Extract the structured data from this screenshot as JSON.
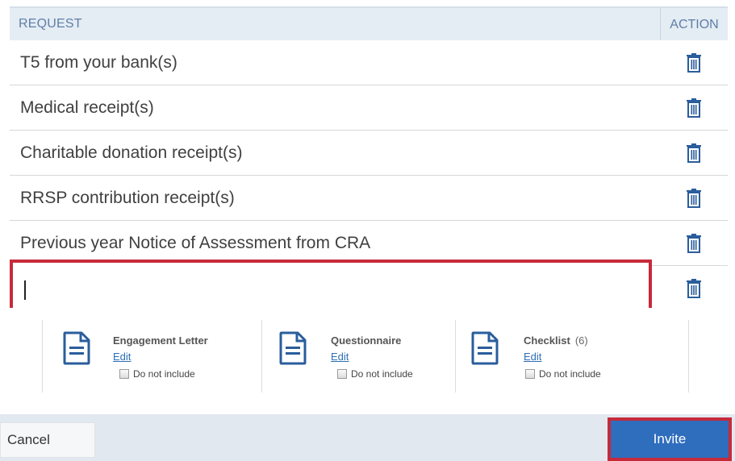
{
  "table": {
    "header_request": "REQUEST",
    "header_action": "ACTION",
    "rows": [
      {
        "label": "T5 from your bank(s)"
      },
      {
        "label": "Medical receipt(s)"
      },
      {
        "label": "Charitable donation receipt(s)"
      },
      {
        "label": "RRSP contribution receipt(s)"
      },
      {
        "label": "Previous year Notice of Assessment from CRA"
      }
    ],
    "new_request_value": "",
    "action_icon": "trash-icon"
  },
  "documents": [
    {
      "title": "Engagement Letter",
      "count": "",
      "edit": "Edit",
      "exclude": "Do not include",
      "icon": "document-icon"
    },
    {
      "title": "Questionnaire",
      "count": "",
      "edit": "Edit",
      "exclude": "Do not include",
      "icon": "document-icon"
    },
    {
      "title": "Checklist",
      "count": "(6)",
      "edit": "Edit",
      "exclude": "Do not include",
      "icon": "document-icon"
    }
  ],
  "footer": {
    "cancel": "Cancel",
    "invite": "Invite"
  },
  "colors": {
    "header_bg": "#e4ecf4",
    "highlight_red": "#c62a3a",
    "primary_blue": "#2f6dbd",
    "icon_blue": "#2a5d9c"
  }
}
